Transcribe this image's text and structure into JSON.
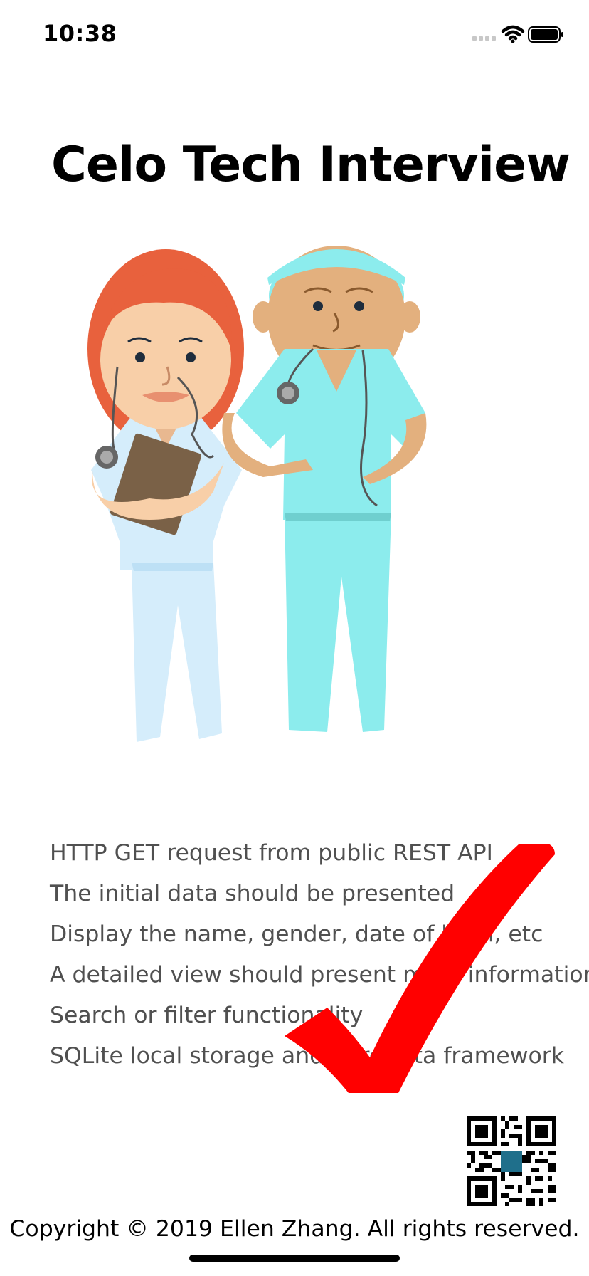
{
  "status_bar": {
    "time": "10:38",
    "icons": [
      "cellular-signal-icon",
      "wifi-icon",
      "battery-icon"
    ]
  },
  "screen": {
    "title": "Celo Tech Interview",
    "illustration": "doctor-and-surgeon-illustration",
    "features": [
      "HTTP GET request from public REST API",
      "The initial data should be presented",
      "Display the name, gender, date of birth, etc",
      "A detailed view should present more information",
      "Search or filter functionality",
      "SQLite local storage and CoreData framework"
    ],
    "overlay": "checkmark-icon",
    "qr_code": "qr-code",
    "copyright": "Copyright © 2019 Ellen Zhang. All rights reserved."
  },
  "colors": {
    "checkmark": "#ff0000",
    "feature_text": "#505050",
    "scrubs_light_blue": "#d5edfb",
    "scrubs_teal": "#8ceced",
    "hair": "#e8613d"
  }
}
